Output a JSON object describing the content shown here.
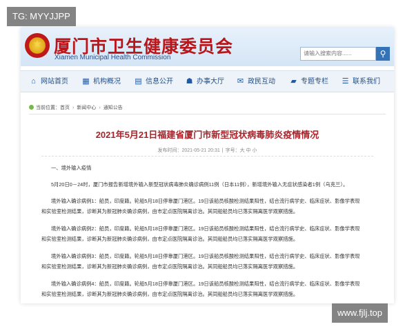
{
  "watermark_top": "TG: MYYJJPP",
  "watermark_bottom": "www.fjlj.top",
  "header": {
    "title": "厦门市卫生健康委员会",
    "subtitle": "Xiamen  Municipal Health Commission",
    "search_placeholder": "请输入搜索内容......",
    "brand_color": "#b8161b"
  },
  "nav": {
    "items": [
      {
        "label": "网站首页",
        "icon": "home-icon"
      },
      {
        "label": "机构概况",
        "icon": "building-icon"
      },
      {
        "label": "信息公开",
        "icon": "document-icon"
      },
      {
        "label": "办事大厅",
        "icon": "service-hall-icon"
      },
      {
        "label": "政民互动",
        "icon": "chat-icon"
      },
      {
        "label": "专题专栏",
        "icon": "folder-icon"
      },
      {
        "label": "联系我们",
        "icon": "contact-icon"
      }
    ]
  },
  "breadcrumb": {
    "prefix": "当前位置：",
    "items": [
      "首页",
      "新闻中心",
      "通知公告"
    ]
  },
  "article": {
    "title": "2021年5月21日福建省厦门市新型冠状病毒肺炎疫情情况",
    "meta_date": "发布时间：2021-05-21 20:31",
    "meta_font": "字号：大 中 小",
    "section1": "一、境外输入疫情",
    "p1": "5月20日0－24时，厦门市报告新增境外输入新型冠状病毒肺炎确诊病例11例（日本11例），新增境外输入无症状感染者1例（乌克兰）。",
    "cases": [
      {
        "line1": "境外输入确诊病例1：船员，印度籍。轮船5月18日停靠厦门港区。19日该船员核酸检测结果阳性，结合流行病学史、临床症状、影像学表现",
        "line2": "和实验室检测结果，诊断其为新冠肺炎确诊病例，由市定点医院隔离诊治。其同船船员均已落实隔离医学观察措施。"
      },
      {
        "line1": "境外输入确诊病例2：船员，印度籍。轮船5月18日停靠厦门港区。19日该船员核酸检测结果阳性，结合流行病学史、临床症状、影像学表现",
        "line2": "和实验室检测结果，诊断其为新冠肺炎确诊病例，由市定点医院隔离诊治。其同船船员均已落实隔离医学观察措施。"
      },
      {
        "line1": "境外输入确诊病例3：船员，印度籍。轮船5月18日停靠厦门港区。19日该船员核酸检测结果阳性，结合流行病学史、临床症状、影像学表现",
        "line2": "和实验室检测结果，诊断其为新冠肺炎确诊病例，由市定点医院隔离诊治。其同船船员均已落实隔离医学观察措施。"
      },
      {
        "line1": "境外输入确诊病例4：船员，印度籍。轮船5月18日停靠厦门港区。19日该船员核酸检测结果阳性，结合流行病学史、临床症状、影像学表现",
        "line2": "和实验室检测结果，诊断其为新冠肺炎确诊病例，由市定点医院隔离诊治。其同船船员均已落实隔离医学观察措施。"
      }
    ],
    "title_color": "#a8242a"
  }
}
